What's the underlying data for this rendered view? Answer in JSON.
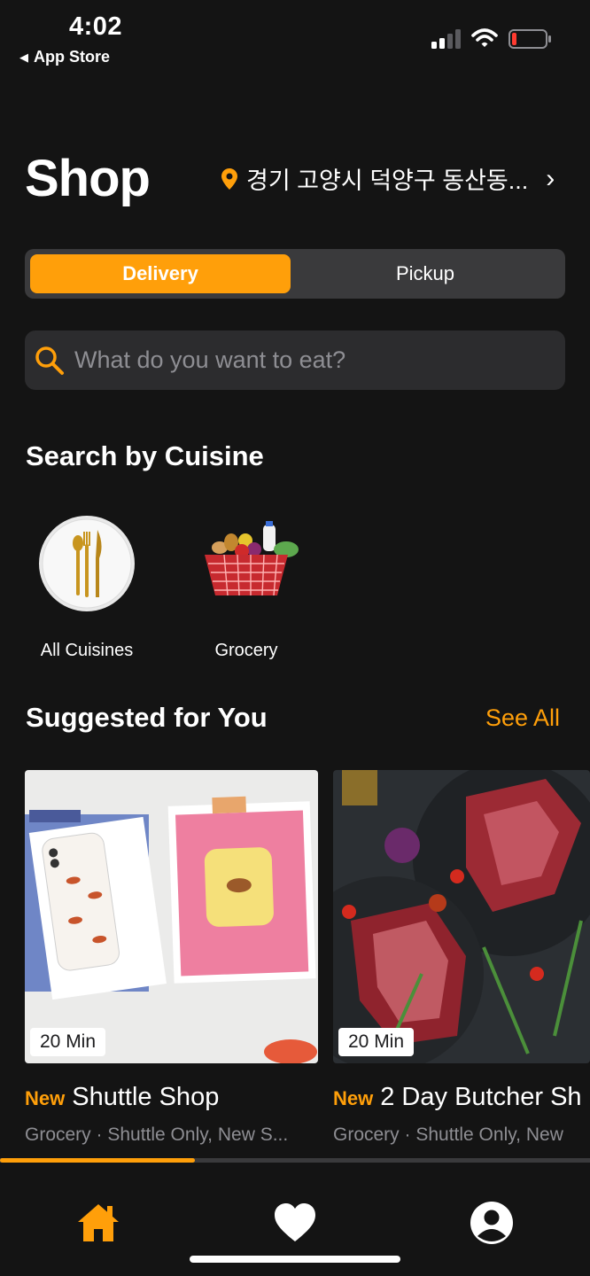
{
  "status_bar": {
    "time": "4:02",
    "back_label": "App Store"
  },
  "header": {
    "title": "Shop",
    "location": "경기 고양시 덕양구 동산동..."
  },
  "segmented": {
    "delivery": "Delivery",
    "pickup": "Pickup",
    "selected": "Delivery"
  },
  "search": {
    "placeholder": "What do you want to eat?"
  },
  "cuisine_section": {
    "title": "Search by Cuisine",
    "items": [
      {
        "label": "All Cuisines"
      },
      {
        "label": "Grocery"
      }
    ]
  },
  "suggested": {
    "title": "Suggested for You",
    "see_all": "See All",
    "cards": [
      {
        "time": "20 Min",
        "badge": "New",
        "name": "Shuttle Shop",
        "subtitle": "Grocery · Shuttle Only, New S..."
      },
      {
        "time": "20 Min",
        "badge": "New",
        "name": "2 Day Butcher Sh",
        "subtitle": "Grocery · Shuttle Only, New"
      }
    ]
  },
  "carousel_progress": 0.33,
  "colors": {
    "accent": "#ff9f0a",
    "background": "#141414"
  },
  "tab_bar": {
    "icons": [
      "home-icon",
      "heart-icon",
      "profile-icon"
    ],
    "active": "home-icon"
  }
}
